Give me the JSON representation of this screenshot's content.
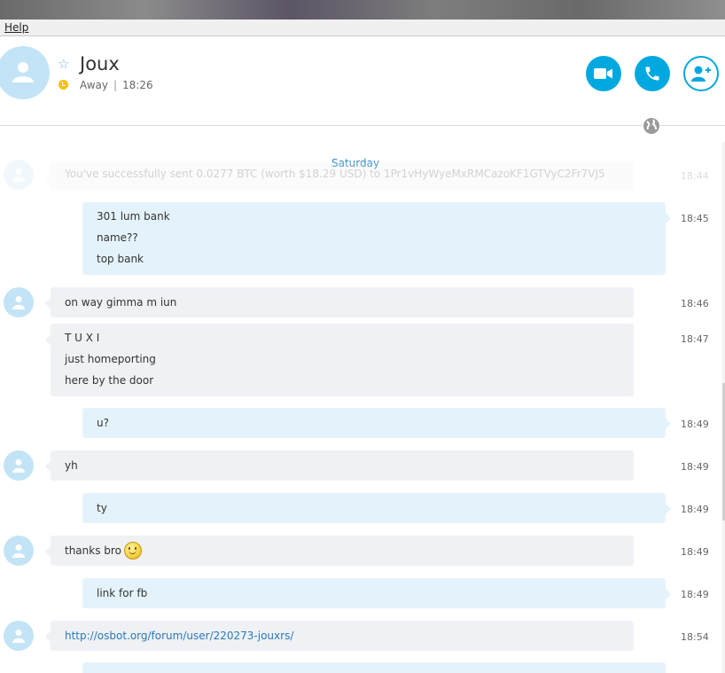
{
  "menu": {
    "help": "Help"
  },
  "contact": {
    "name": "Joux",
    "status": "Away",
    "time": "18:26"
  },
  "icons": {
    "favorite": "star-icon",
    "presence": "away-clock-icon",
    "video": "video-camera-icon",
    "call": "phone-icon",
    "add": "add-contact-icon",
    "translator": "globe-icon"
  },
  "colors": {
    "accent": "#00a8e0",
    "away": "#f7c200",
    "incoming_bubble": "#eff1f5",
    "outgoing_bubble": "#e4f3fb"
  },
  "chat": {
    "day": "Saturday",
    "messages": [
      {
        "dir": "in",
        "lines": [
          "You've successfully sent 0.0277 BTC (worth $18.29 USD) to 1Pr1vHyWyeMxRMCazoKF1GTVyC2Fr7VJ5"
        ],
        "time": "18:44",
        "faded": true
      },
      {
        "dir": "out",
        "lines": [
          "301 lum bank",
          "name??",
          "top bank"
        ],
        "time": "18:45"
      },
      {
        "dir": "in",
        "lines": [
          "on way gimma m iun"
        ],
        "time": "18:46"
      },
      {
        "dir": "in",
        "lines": [
          "T U X I",
          "just homeporting",
          "here by the door"
        ],
        "time": "18:47"
      },
      {
        "dir": "out",
        "lines": [
          "u?"
        ],
        "time": "18:49"
      },
      {
        "dir": "in",
        "lines": [
          "yh"
        ],
        "time": "18:49"
      },
      {
        "dir": "out",
        "lines": [
          "ty"
        ],
        "time": "18:49"
      },
      {
        "dir": "in",
        "lines": [
          "thanks bro"
        ],
        "time": "18:49",
        "emoji": "smile-emoji"
      },
      {
        "dir": "out",
        "lines": [
          "link for fb"
        ],
        "time": "18:49"
      },
      {
        "dir": "in",
        "lines": [
          "http://osbot.org/forum/user/220273-jouxrs/"
        ],
        "time": "18:54",
        "link": true
      }
    ]
  }
}
